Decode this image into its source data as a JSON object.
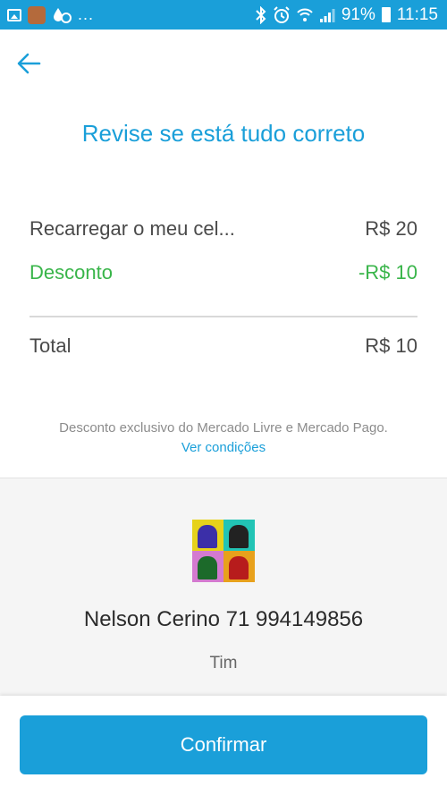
{
  "status_bar": {
    "dots": "...",
    "battery_percent": "91%",
    "time": "11:15"
  },
  "header": {
    "title": "Revise se está tudo correto"
  },
  "summary": {
    "recharge_label": "Recarregar o meu cel...",
    "recharge_value": "R$ 20",
    "discount_label": "Desconto",
    "discount_value": "-R$ 10",
    "total_label": "Total",
    "total_value": "R$ 10"
  },
  "disclaimer": {
    "text": "Desconto exclusivo do Mercado Livre e Mercado Pago.",
    "link": "Ver condições"
  },
  "contact": {
    "name": "Nelson Cerino 71 994149856",
    "carrier": "Tim"
  },
  "actions": {
    "confirm_label": "Confirmar"
  },
  "colors": {
    "accent": "#1a9fd9",
    "discount": "#39b54a"
  }
}
